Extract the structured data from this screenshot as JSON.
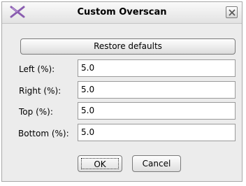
{
  "dialog": {
    "title": "Custom Overscan",
    "icons": {
      "app": "x-logo-icon",
      "close": "close-icon"
    }
  },
  "restore_label": "Restore defaults",
  "fields": [
    {
      "label": "Left (%):",
      "value": "5.0"
    },
    {
      "label": "Right (%):",
      "value": "5.0"
    },
    {
      "label": "Top (%):",
      "value": "5.0"
    },
    {
      "label": "Bottom (%):",
      "value": "5.0"
    }
  ],
  "buttons": {
    "ok": "OK",
    "cancel": "Cancel"
  }
}
